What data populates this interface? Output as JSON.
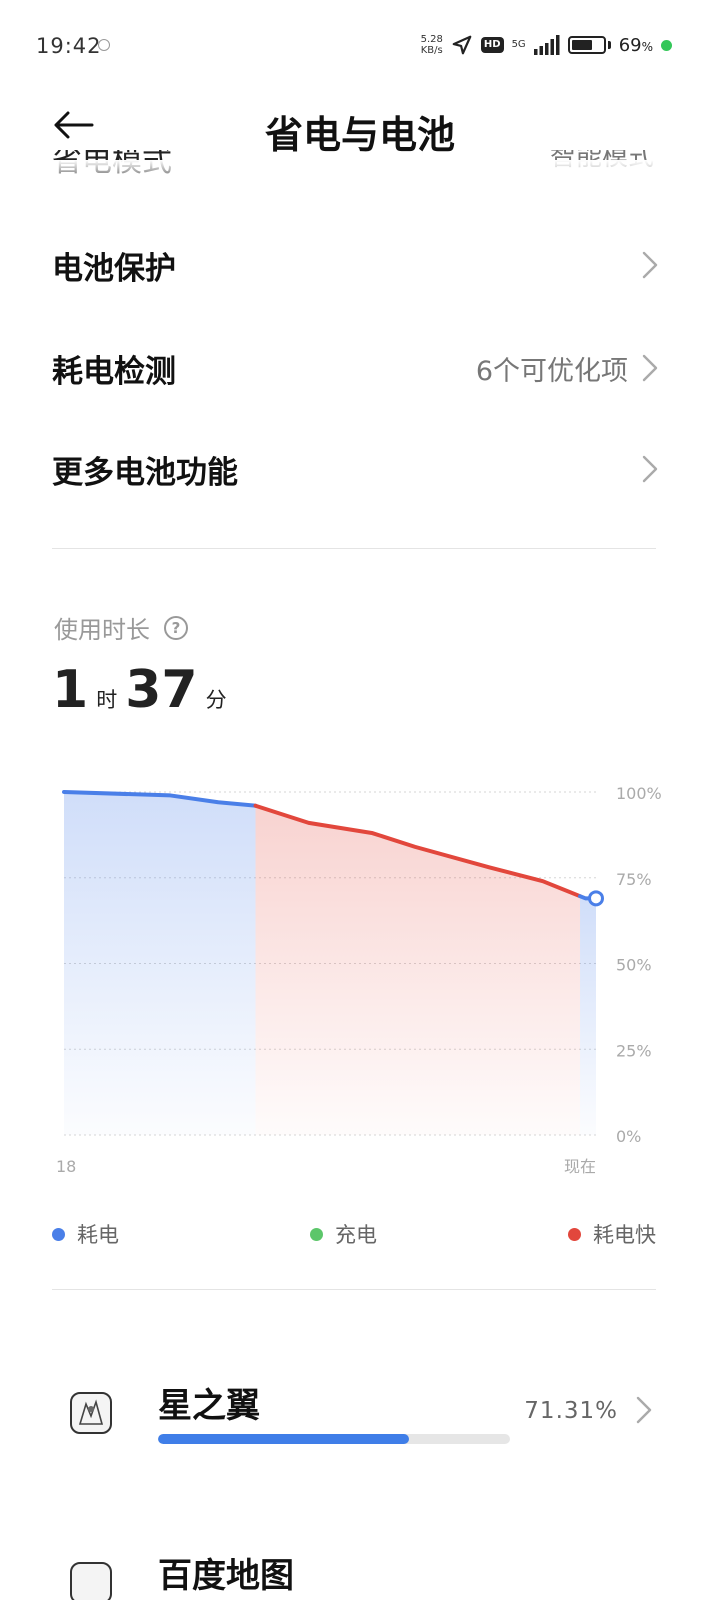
{
  "status_bar": {
    "time": "19:42",
    "net_speed_value": "5.28",
    "net_speed_unit": "KB/s",
    "hd_label": "HD",
    "net_type": "5G",
    "battery_percent": "69",
    "battery_percent_suffix": "%",
    "battery_level": 0.69
  },
  "header": {
    "title": "省电与电池",
    "back_icon": "back-arrow-icon"
  },
  "partial_row": {
    "label": "省电模式",
    "value": "智能模式"
  },
  "settings": [
    {
      "label": "电池保护",
      "value": ""
    },
    {
      "label": "耗电检测",
      "value": "6个可优化项"
    },
    {
      "label": "更多电池功能",
      "value": ""
    }
  ],
  "usage": {
    "label": "使用时长",
    "hours": "1",
    "hours_unit": "时",
    "minutes": "37",
    "minutes_unit": "分"
  },
  "chart_data": {
    "type": "area",
    "x_start_label": "18",
    "x_end_label": "现在",
    "y_ticks": [
      "100%",
      "75%",
      "50%",
      "25%",
      "0%"
    ],
    "ylim": [
      0,
      100
    ],
    "x": [
      0,
      0.2,
      0.29,
      0.36,
      0.46,
      0.58,
      0.66,
      0.8,
      0.9,
      0.98,
      1.0
    ],
    "y": [
      100,
      99,
      97,
      96,
      91,
      88,
      84,
      78,
      74,
      69,
      69
    ],
    "segments": [
      {
        "kind": "耗电",
        "from": 0,
        "to": 0.36
      },
      {
        "kind": "耗电快",
        "from": 0.36,
        "to": 0.97
      },
      {
        "kind": "耗电",
        "from": 0.97,
        "to": 1.0
      }
    ],
    "current_level": 69,
    "colors": {
      "normal": "#4a7fe8",
      "charging": "#5cc66a",
      "fast": "#e2473c"
    }
  },
  "legend": [
    {
      "label": "耗电",
      "color": "#4a7fe8"
    },
    {
      "label": "充电",
      "color": "#5cc66a"
    },
    {
      "label": "耗电快",
      "color": "#e2473c"
    }
  ],
  "apps": [
    {
      "name": "星之翼",
      "percent": "71.31%",
      "share": 0.7131
    },
    {
      "name": "百度地图",
      "percent": "",
      "share": 0
    }
  ]
}
